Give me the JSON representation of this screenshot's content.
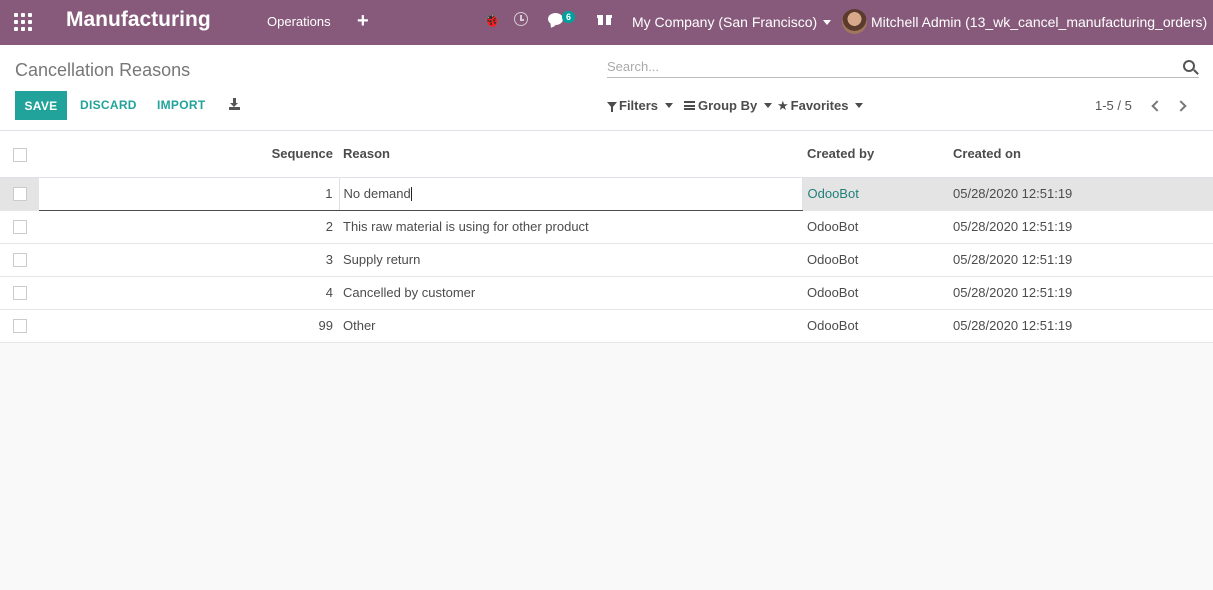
{
  "navbar": {
    "brand": "Manufacturing",
    "menu_operations": "Operations",
    "plus": "+",
    "chat_count": "6",
    "company": "My Company (San Francisco)",
    "user": "Mitchell Admin (13_wk_cancel_manufacturing_orders)",
    "bg_color": "#875a7b"
  },
  "control": {
    "breadcrumb": "Cancellation Reasons",
    "search_placeholder": "Search...",
    "save_label": "SAVE",
    "discard_label": "DISCARD",
    "import_label": "IMPORT",
    "filters_label": "Filters",
    "groupby_label": "Group By",
    "favorites_label": "Favorites",
    "pager_value": "1-5 / 5",
    "accent_color": "#21a39b"
  },
  "table": {
    "headers": {
      "sequence": "Sequence",
      "reason": "Reason",
      "created_by": "Created by",
      "created_on": "Created on"
    },
    "rows": [
      {
        "sequence": "1",
        "reason": "No demand",
        "created_by": "OdooBot",
        "created_on": "05/28/2020 12:51:19"
      },
      {
        "sequence": "2",
        "reason": "This raw material is using for other product",
        "created_by": "OdooBot",
        "created_on": "05/28/2020 12:51:19"
      },
      {
        "sequence": "3",
        "reason": "Supply return",
        "created_by": "OdooBot",
        "created_on": "05/28/2020 12:51:19"
      },
      {
        "sequence": "4",
        "reason": "Cancelled by customer",
        "created_by": "OdooBot",
        "created_on": "05/28/2020 12:51:19"
      },
      {
        "sequence": "99",
        "reason": "Other",
        "created_by": "OdooBot",
        "created_on": "05/28/2020 12:51:19"
      }
    ]
  }
}
